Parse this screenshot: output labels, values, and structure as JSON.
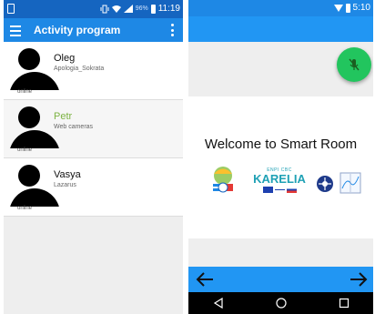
{
  "left_screen": {
    "status_bar": {
      "time": "11:19",
      "battery": "96%"
    },
    "toolbar": {
      "title": "Activity program"
    },
    "contacts": [
      {
        "name": "Oleg",
        "subtitle": "Apologia_Sokrata",
        "status": "online"
      },
      {
        "name": "Petr",
        "subtitle": "Web cameras",
        "status": "online",
        "selected": true
      },
      {
        "name": "Vasya",
        "subtitle": "Lazarus",
        "status": "online"
      }
    ]
  },
  "right_screen": {
    "status_bar": {
      "time": "5:10"
    },
    "welcome_text": "Welcome to Smart Room",
    "logos": {
      "eauct": "EAUCT",
      "karelia_top": "ENPI CBC",
      "karelia_word": "KARELIA"
    },
    "colors": {
      "fab": "#22c55e",
      "primary": "#2196f3",
      "selected_name": "#7cb342"
    }
  }
}
